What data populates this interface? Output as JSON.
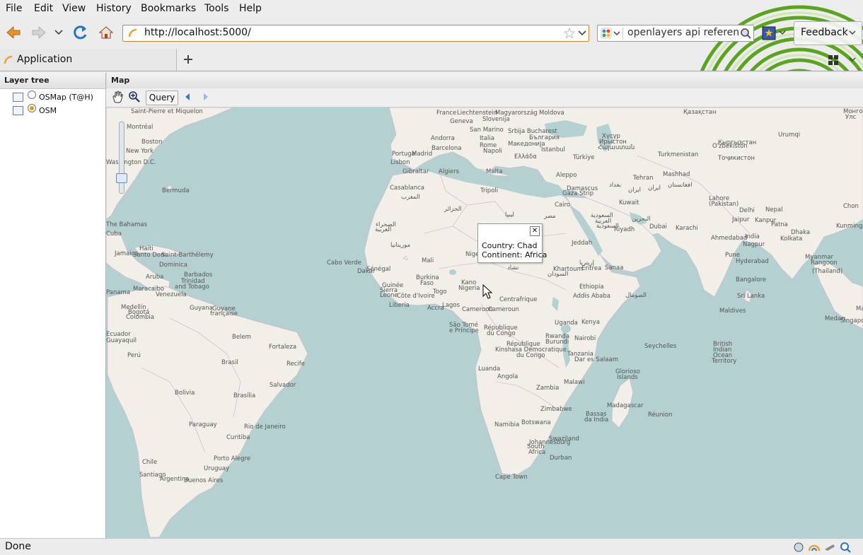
{
  "menu": [
    "File",
    "Edit",
    "View",
    "History",
    "Bookmarks",
    "Tools",
    "Help"
  ],
  "address": {
    "url": "http://localhost:5000/"
  },
  "search": {
    "value": "openlayers api reference"
  },
  "feedback_label": "Feedback",
  "tab": {
    "label": "Application"
  },
  "layer_tree": {
    "title": "Layer tree",
    "layers": [
      {
        "label": "OSMap (T@H)",
        "selected": false
      },
      {
        "label": "OSM",
        "selected": true
      }
    ]
  },
  "map_panel": {
    "title": "Map",
    "query_label": "Query"
  },
  "popup": {
    "country": "Country: Chad",
    "continent": "Continent: Africa"
  },
  "status": {
    "text": "Done"
  },
  "colors": {
    "sea": "#b5d0d0",
    "land": "#f2efe9",
    "accent": "#c88a2a"
  }
}
